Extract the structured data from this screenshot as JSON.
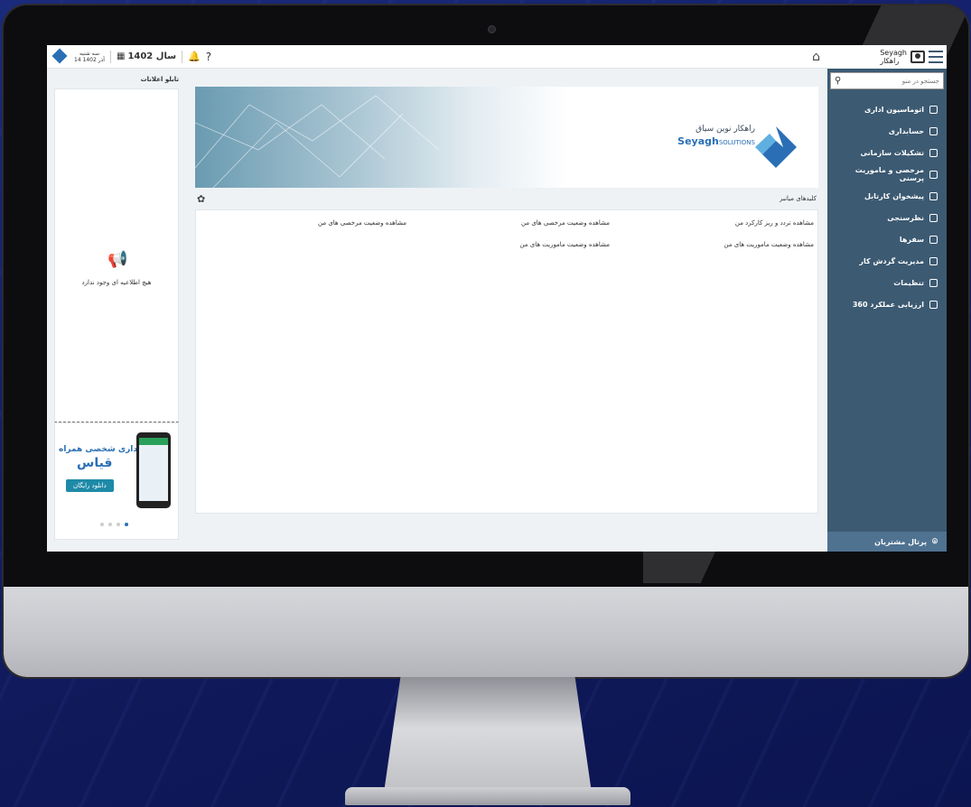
{
  "topbar": {
    "date_line1": "سه شنبه",
    "date_line2": "14 آذر 1402",
    "year_label": "سال 1402",
    "help": "?"
  },
  "sidebar": {
    "user_name": "Seyagh",
    "user_role": "راهکار",
    "search_placeholder": "جستجو در منو",
    "items": [
      {
        "label": "اتوماسیون اداری",
        "icon": "mail-icon"
      },
      {
        "label": "حسابداری",
        "icon": "ledger-icon"
      },
      {
        "label": "تشکیلات سازمانی",
        "icon": "org-chart-icon"
      },
      {
        "label": "مرخصی و ماموریت پرسنی",
        "icon": "leave-icon"
      },
      {
        "label": "پیشخوان کارتابل",
        "icon": "inbox-icon"
      },
      {
        "label": "نظرسنجی",
        "icon": "survey-icon"
      },
      {
        "label": "سفرها",
        "icon": "travel-icon"
      },
      {
        "label": "مدیریت گردش کار",
        "icon": "workflow-icon"
      },
      {
        "label": "تنظیمات",
        "icon": "gear-icon"
      },
      {
        "label": "ارزیابی عملکرد 360",
        "icon": "evaluation-icon"
      }
    ],
    "portal": "پرتال مشتریان"
  },
  "left_panel": {
    "title": "تابلو اعلانات",
    "empty_text": "هیچ اطلاعیه ای وجود ندارد",
    "ad_title": "حسابداری شخصی همراه",
    "ad_brand": "قیاس",
    "ad_button": "دانلود رایگان"
  },
  "banner": {
    "brand_fa": "راهکار نوین سیاق",
    "brand_en": "Seyagh",
    "brand_en_suffix": "SOLUTIONS"
  },
  "links": {
    "title": "کلیدهای میانبر",
    "items": [
      "مشاهده تردد و ریز کارکرد من",
      "مشاهده وضعیت مرخصی های من",
      "مشاهده وضعیت مرخصی های من",
      "مشاهده وضعیت ماموریت های من",
      "مشاهده وضعیت ماموریت های من"
    ]
  },
  "colors": {
    "sidebar": "#3c5a72",
    "accent": "#2a6fb5",
    "background": "#1b2a7a"
  }
}
